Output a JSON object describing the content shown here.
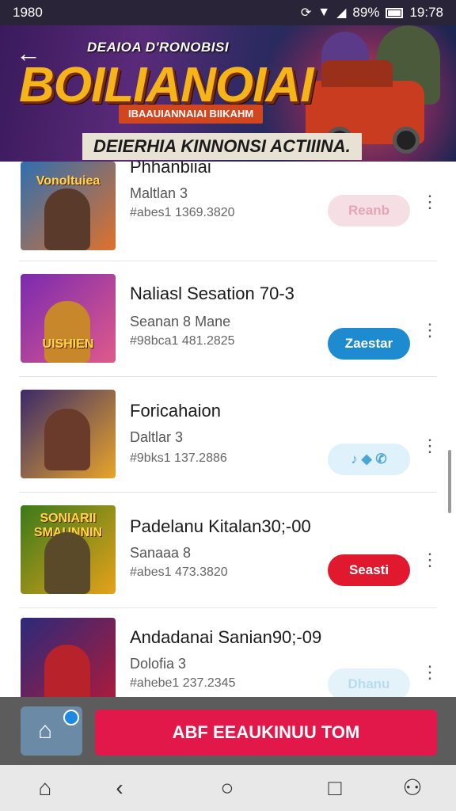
{
  "status_bar": {
    "left_text": "1980",
    "battery_text": "89%",
    "time": "19:78",
    "icons": [
      "sync-icon",
      "wifi-icon",
      "signal-icon",
      "battery-icon"
    ]
  },
  "banner": {
    "top_text": "DEAIOA D'RONOBISI",
    "title": "BOILIANOIAI",
    "pill_text": "IBAAUIANNAIAI BIIKAHM",
    "subtitle": "DEIERHIA KINNONSI ACTIIINA."
  },
  "list": {
    "items": [
      {
        "thumb_label": "Vonoltuiea",
        "thumb_colors": [
          "#2f6fb0",
          "#e0712b"
        ],
        "title": "Phhanbiiai",
        "sub": "Maltlan 3",
        "meta": "#abes1 1369.3820",
        "button_label": "Reanb",
        "button_color": "#f6dfe4",
        "button_text_color": "#e4a6b4"
      },
      {
        "thumb_label": "UISHIEN",
        "thumb_colors": [
          "#7a2ab0",
          "#e05a8a"
        ],
        "title": "Naliasl Sesation 70-3",
        "sub": "Seanan 8 Mane",
        "meta": "#98bca1 481.2825",
        "button_label": "Zaestar",
        "button_color": "#1e8ad0",
        "button_text_color": "#ffffff"
      },
      {
        "thumb_label": "",
        "thumb_colors": [
          "#3a2a6a",
          "#e8a52a"
        ],
        "title": "Foricahaion",
        "sub": "Daltlar 3",
        "meta": "#9bks1 137.2886",
        "button_label": "♪ ◆ ✆",
        "button_color": "#dff1fb",
        "button_text_color": "#4aa6d8"
      },
      {
        "thumb_label": "SONIARII SMAUNNIN",
        "thumb_colors": [
          "#3a7a1a",
          "#e6a21a"
        ],
        "title": "Padelanu Kitalan30;-00",
        "sub": "Sanaaa 8",
        "meta": "#abes1 473.3820",
        "button_label": "Seasti",
        "button_color": "#e0192e",
        "button_text_color": "#ffffff"
      },
      {
        "thumb_label": "",
        "thumb_colors": [
          "#2a2a7a",
          "#b01a3a"
        ],
        "title": "Andadanai Sanian90;-09",
        "sub": "Dolofia 3",
        "meta": "#ahebe1 237.2345",
        "button_label": "Dhanu",
        "button_color": "#e4f3fa",
        "button_text_color": "#b8dcec"
      }
    ]
  },
  "bottom_bar": {
    "cta_label": "ABF EEAUKINUU TOM"
  },
  "nav_bar": {
    "items": [
      "home-icon",
      "back-icon",
      "circle-home-icon",
      "recents-icon",
      "add-user-icon"
    ]
  }
}
